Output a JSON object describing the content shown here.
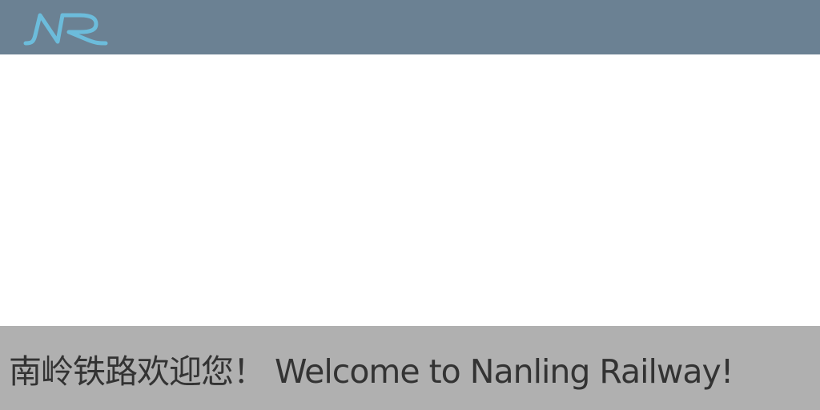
{
  "header": {
    "logo_text": "NR",
    "logo_color": "#6cbcdb",
    "background": "#6b8193"
  },
  "footer": {
    "background": "#b0b0b0",
    "welcome_text": "南岭铁路欢迎您！ Welcome  to Nanling Railway!"
  }
}
